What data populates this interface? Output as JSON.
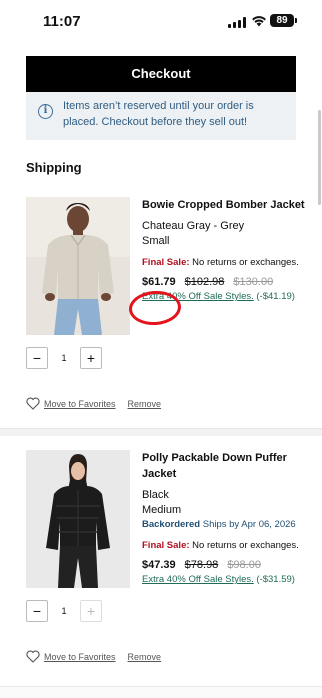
{
  "status_bar": {
    "time": "11:07",
    "battery": "89"
  },
  "checkout": {
    "label": "Checkout"
  },
  "notice": {
    "text": "Items aren’t reserved until your order is placed. Checkout before they sell out!"
  },
  "section": {
    "title": "Shipping"
  },
  "items": [
    {
      "name": "Bowie Cropped Bomber Jacket",
      "color": "Chateau Gray - Grey",
      "size": "Small",
      "backorder_label": "",
      "backorder_date": "",
      "final_sale_label": "Final Sale:",
      "final_sale_text": "No returns or exchanges.",
      "price_now": "$61.79",
      "price_was": "$102.98",
      "price_orig": "$130.00",
      "promo_link": "Extra 40% Off Sale Styles.",
      "promo_amount": "(-$41.19)",
      "quantity": "1",
      "favorite_label": "Move to Favorites",
      "remove_label": "Remove",
      "photo_colors": {
        "bg": "#e8e4dd",
        "jacket": "#d8d2c6",
        "jeans": "#8fb0d0",
        "skin": "#6b4634"
      }
    },
    {
      "name": "Polly Packable Down Puffer Jacket",
      "color": "Black",
      "size": "Medium",
      "backorder_label": "Backordered",
      "backorder_date": "Ships by Apr 06, 2026",
      "final_sale_label": "Final Sale:",
      "final_sale_text": "No returns or exchanges.",
      "price_now": "$47.39",
      "price_was": "$78.98",
      "price_orig": "$98.00",
      "promo_link": "Extra 40% Off Sale Styles.",
      "promo_amount": "(-$31.59)",
      "quantity": "1",
      "favorite_label": "Move to Favorites",
      "remove_label": "Remove",
      "photo_colors": {
        "bg": "#e9e9e9",
        "jacket": "#1c1c1c",
        "jeans": "#222",
        "skin": "#e5c0a6"
      }
    }
  ],
  "colors": {
    "sale_red": "#b0101f",
    "promo_green": "#1f6b57",
    "notice_blue": "#2f5d84",
    "annotation_red": "#e4141d"
  }
}
